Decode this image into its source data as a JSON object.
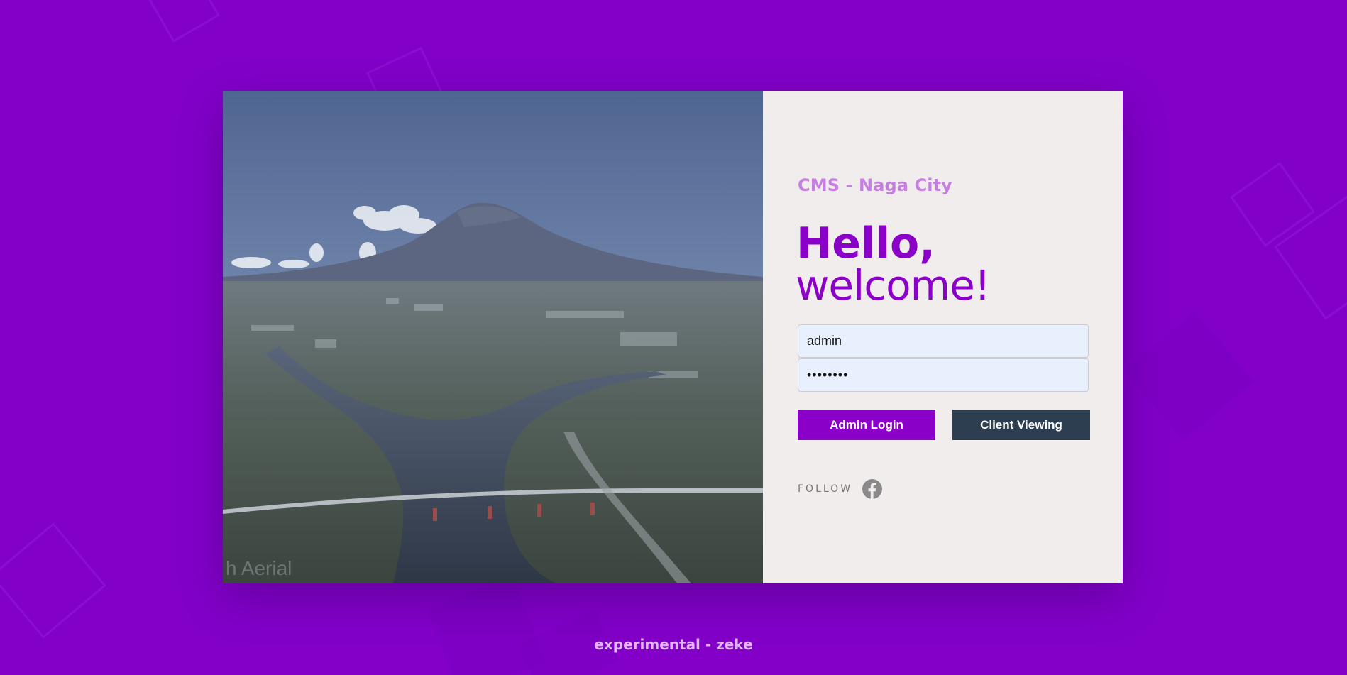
{
  "brand": {
    "title": "CMS - Naga City"
  },
  "greeting": {
    "line1": "Hello,",
    "line2": "welcome!"
  },
  "login_form": {
    "username_value": "admin",
    "password_value": "password",
    "admin_button_label": "Admin Login",
    "client_button_label": "Client Viewing"
  },
  "social": {
    "follow_label": "FOLLOW",
    "icon": "facebook-icon"
  },
  "footer": {
    "text": "experimental - zeke"
  },
  "photo": {
    "description_icon": "city-aerial-photo",
    "watermark": "h Aerial"
  },
  "colors": {
    "background": "#8300c9",
    "accent": "#8a00c8",
    "brand_text": "#c47fe0",
    "panel": "#f1eded",
    "client_button": "#2c3e50",
    "input_bg": "#e8f0fe"
  }
}
